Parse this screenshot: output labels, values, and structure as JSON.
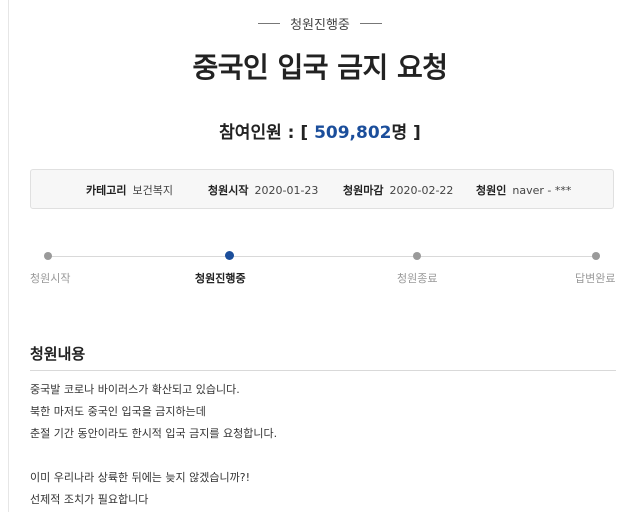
{
  "status": "청원진행중",
  "title": "중국인 입국 금지 요청",
  "participants": {
    "label": "참여인원 : [",
    "count": "509,802",
    "suffix": "명 ]"
  },
  "info": {
    "category_label": "카테고리",
    "category_value": "보건복지",
    "start_label": "청원시작",
    "start_value": "2020-01-23",
    "end_label": "청원마감",
    "end_value": "2020-02-22",
    "petitioner_label": "청원인",
    "petitioner_value": "naver - ***"
  },
  "progress": {
    "steps": [
      {
        "label": "청원시작",
        "active": false
      },
      {
        "label": "청원진행중",
        "active": true
      },
      {
        "label": "청원종료",
        "active": false
      },
      {
        "label": "답변완료",
        "active": false
      }
    ]
  },
  "content": {
    "heading": "청원내용",
    "lines": [
      "중국발 코로나 바이러스가 확산되고 있습니다.",
      "북한 마저도 중국인 입국을 금지하는데",
      "춘절 기간 동안이라도 한시적 입국 금지를 요청합니다.",
      "",
      "이미 우리나라 상륙한 뒤에는 늦지 않겠습니까?!",
      "선제적 조치가 필요합니다"
    ]
  }
}
